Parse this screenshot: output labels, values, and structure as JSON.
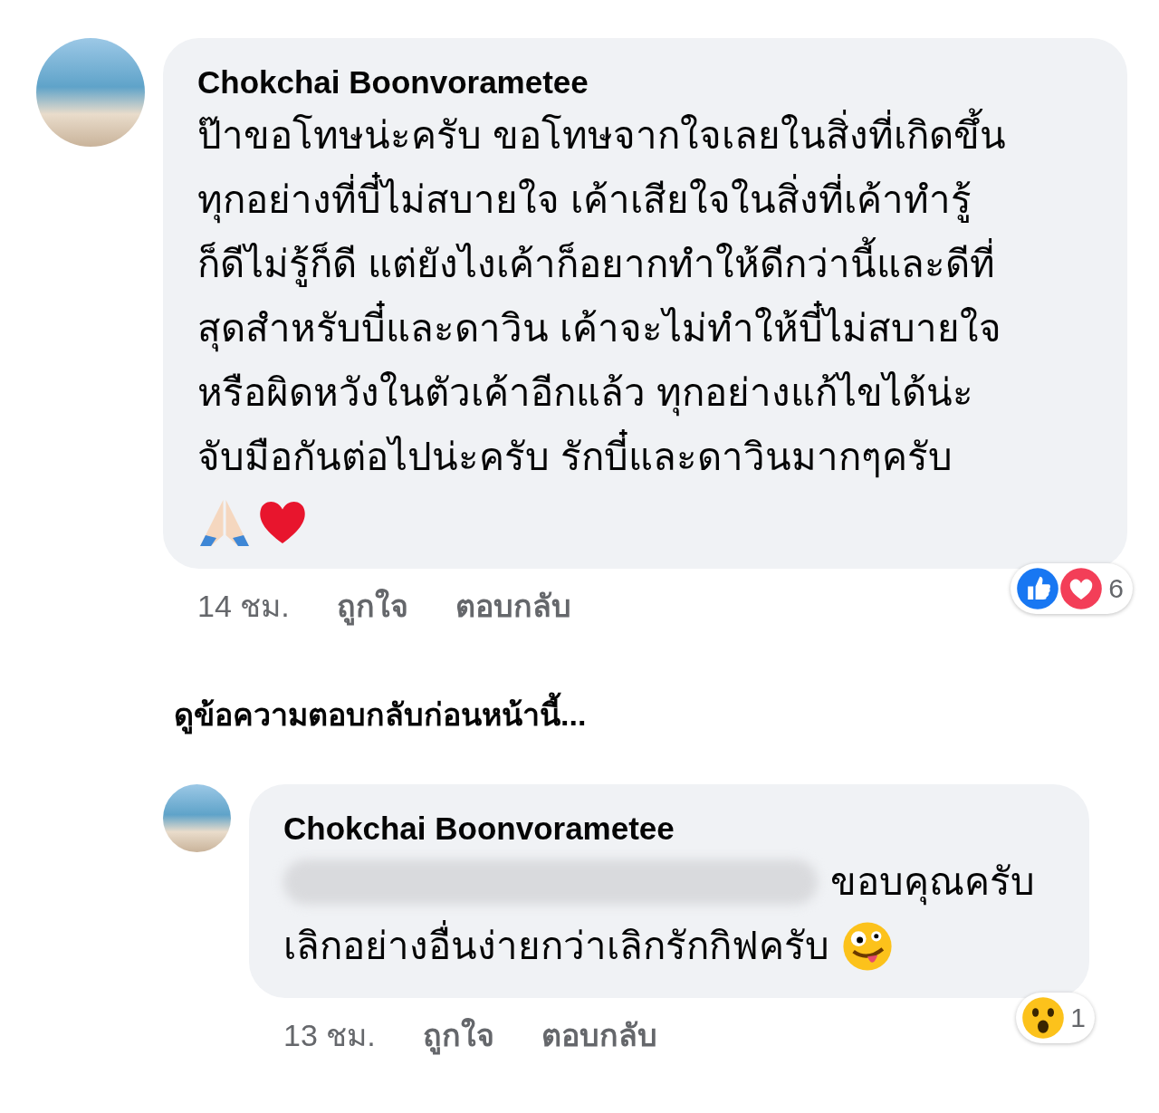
{
  "comment": {
    "author": "Chokchai Boonvorametee",
    "text": "ป๊าขอโทษน่ะครับ ขอโทษจากใจเลยในสิ่งที่เกิดขึ้น\nทุกอย่างที่บี๋ไม่สบายใจ เค้าเสียใจในสิ่งที่เค้าทำรู้\nก็ดีไม่รู้ก็ดี แต่ยังไงเค้าก็อยากทำให้ดีกว่านี้และดีที่\nสุดสำหรับบี๋และดาวิน เค้าจะไม่ทำให้บี๋ไม่สบายใจ\nหรือผิดหวังในตัวเค้าอีกแล้ว ทุกอย่างแก้ไขได้น่ะ\nจับมือกันต่อไปน่ะครับ รักบี๋และดาวินมากๆครับ",
    "emojis": [
      {
        "kind": "pray"
      },
      {
        "kind": "heart"
      }
    ],
    "time": "14 ชม.",
    "actions": [
      "ถูกใจ",
      "ตอบกลับ"
    ],
    "reactions": {
      "icons": [
        {
          "kind": "like"
        },
        {
          "kind": "love"
        }
      ],
      "count": "6"
    }
  },
  "previous_replies_link": "ดูข้อความตอบกลับก่อนหน้านี้...",
  "reply": {
    "author": "Chokchai Boonvorametee",
    "mention_redacted": true,
    "text": "ขอบคุณครับ",
    "text_line_2": "เลิกอย่างอื่นง่ายกว่าเลิกรักกิฟครับ",
    "emojis": [
      {
        "kind": "zany"
      }
    ],
    "time": "13 ชม.",
    "actions": [
      "ถูกใจ",
      "ตอบกลับ"
    ],
    "reactions": {
      "icons": [
        {
          "kind": "wow"
        }
      ],
      "count": "1"
    }
  }
}
